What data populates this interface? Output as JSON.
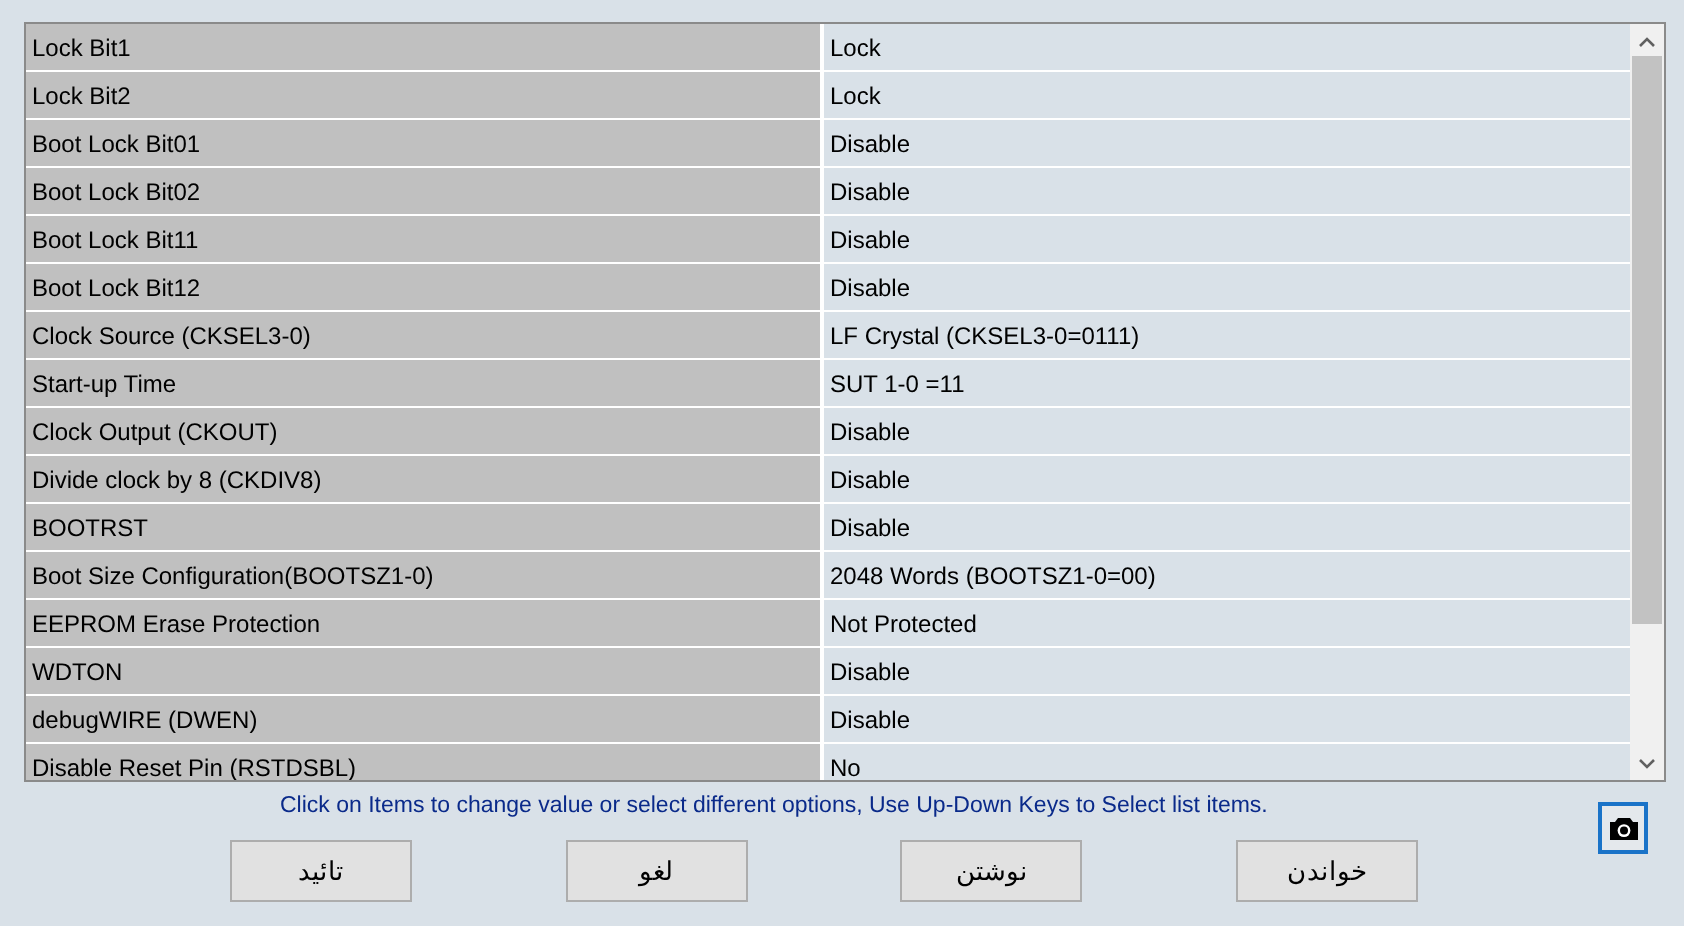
{
  "settings_table": {
    "rows": [
      {
        "name": "Lock Bit1",
        "value": "Lock"
      },
      {
        "name": "Lock Bit2",
        "value": "Lock"
      },
      {
        "name": "Boot Lock Bit01",
        "value": "Disable"
      },
      {
        "name": "Boot Lock Bit02",
        "value": "Disable"
      },
      {
        "name": "Boot Lock Bit11",
        "value": "Disable"
      },
      {
        "name": "Boot Lock Bit12",
        "value": "Disable"
      },
      {
        "name": "Clock Source (CKSEL3-0)",
        "value": "LF Crystal (CKSEL3-0=0111)"
      },
      {
        "name": "Start-up Time",
        "value": "SUT 1-0 =11"
      },
      {
        "name": "Clock Output (CKOUT)",
        "value": "Disable"
      },
      {
        "name": "Divide clock by 8 (CKDIV8)",
        "value": "Disable"
      },
      {
        "name": "BOOTRST",
        "value": "Disable"
      },
      {
        "name": "Boot Size Configuration(BOOTSZ1-0)",
        "value": "2048 Words (BOOTSZ1-0=00)"
      },
      {
        "name": "EEPROM Erase Protection",
        "value": "Not Protected"
      },
      {
        "name": "WDTON",
        "value": "Disable"
      },
      {
        "name": "debugWIRE (DWEN)",
        "value": "Disable"
      },
      {
        "name": "Disable Reset Pin  (RSTDSBL)",
        "value": "No"
      }
    ]
  },
  "hint": "Click on Items to change value or select different options, Use Up-Down Keys to Select list items.",
  "buttons": [
    "خواندن",
    "نوشتن",
    "لغو",
    "تائید"
  ]
}
